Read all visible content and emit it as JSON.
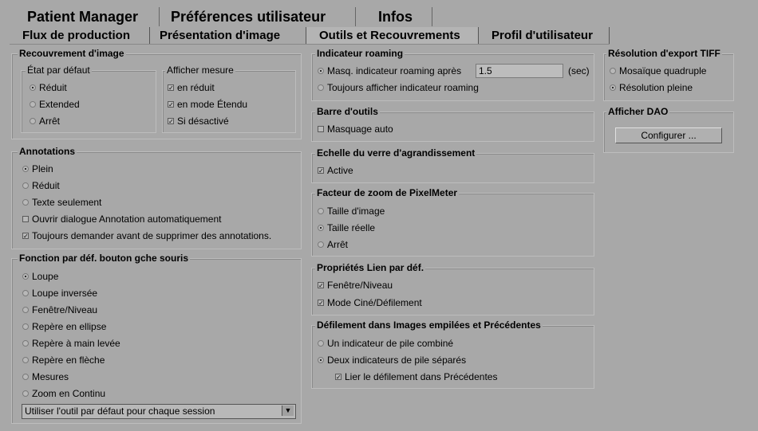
{
  "tabs_top": [
    "Patient Manager",
    "Préférences utilisateur",
    "Infos"
  ],
  "tabs_sub": [
    "Flux de production",
    "Présentation d'image",
    "Outils et Recouvrements",
    "Profil d'utilisateur"
  ],
  "active_sub_tab": "Outils et Recouvrements",
  "recouvrement": {
    "title": "Recouvrement d'image",
    "etat": {
      "title": "État par défaut",
      "options": [
        "Réduit",
        "Extended",
        "Arrêt"
      ],
      "selected": "Réduit"
    },
    "afficher": {
      "title": "Afficher mesure",
      "options": [
        "en réduit",
        "en mode Étendu",
        "Si désactivé"
      ],
      "checked": [
        true,
        true,
        true
      ]
    }
  },
  "annotations": {
    "title": "Annotations",
    "radios": [
      "Plein",
      "Réduit",
      "Texte seulement"
    ],
    "selected": "Plein",
    "checks": [
      {
        "label": "Ouvrir dialogue Annotation automatiquement",
        "checked": false
      },
      {
        "label": "Toujours demander avant de supprimer des annotations.",
        "checked": true
      }
    ]
  },
  "fonction": {
    "title": "Fonction par déf. bouton gche souris",
    "options": [
      "Loupe",
      "Loupe inversée",
      "Fenêtre/Niveau",
      "Repère en ellipse",
      "Repère à main levée",
      "Repère en flèche",
      "Mesures",
      "Zoom en Continu"
    ],
    "selected": "Loupe",
    "dropdown": "Utiliser l'outil par défaut pour chaque session"
  },
  "roaming": {
    "title": "Indicateur roaming",
    "opt1": "Masq. indicateur roaming après",
    "value": "1.5",
    "unit": "(sec)",
    "opt2": "Toujours afficher indicateur roaming",
    "selected": 0
  },
  "barre": {
    "title": "Barre d'outils",
    "check": "Masquage auto",
    "checked": false
  },
  "echelle": {
    "title": "Echelle du verre d'agrandissement",
    "check": "Active",
    "checked": true
  },
  "zoom": {
    "title": "Facteur de zoom de PixelMeter",
    "options": [
      "Taille d'image",
      "Taille réelle",
      "Arrêt"
    ],
    "selected": "Taille réelle"
  },
  "lien": {
    "title": "Propriétés Lien par déf.",
    "checks": [
      "Fenêtre/Niveau",
      "Mode Ciné/Défilement"
    ],
    "checked": [
      true,
      true
    ]
  },
  "defilement": {
    "title": "Défilement dans Images empilées et Précédentes",
    "options": [
      "Un indicateur de pile combiné",
      "Deux indicateurs de pile séparés"
    ],
    "selected": 1,
    "check": "Lier le défilement dans Précédentes",
    "checked": true
  },
  "tiff": {
    "title": "Résolution d'export TIFF",
    "options": [
      "Mosaïque quadruple",
      "Résolution pleine"
    ],
    "selected": "Résolution pleine"
  },
  "dao": {
    "title": "Afficher DAO",
    "button": "Configurer ..."
  }
}
